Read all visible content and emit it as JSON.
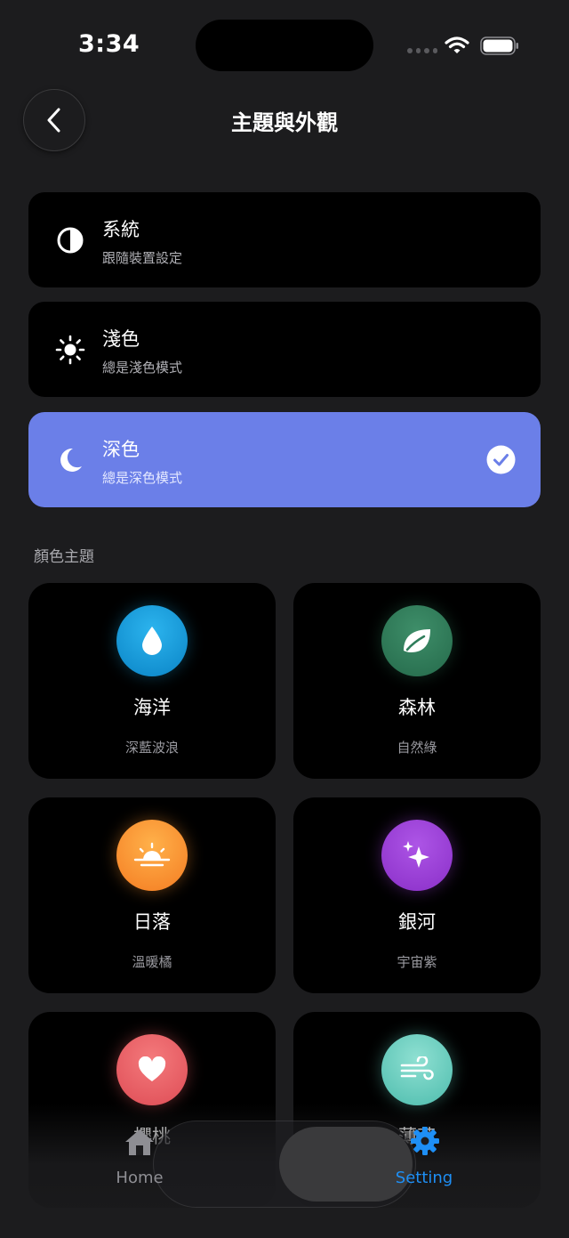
{
  "status": {
    "time": "3:34"
  },
  "header": {
    "title": "主題與外觀"
  },
  "modes": [
    {
      "title": "系統",
      "subtitle": "跟隨裝置設定",
      "icon": "half-circle-icon",
      "selected": false
    },
    {
      "title": "淺色",
      "subtitle": "總是淺色模式",
      "icon": "sun-icon",
      "selected": false
    },
    {
      "title": "深色",
      "subtitle": "總是深色模式",
      "icon": "moon-icon",
      "selected": true
    }
  ],
  "section": {
    "label": "顏色主題"
  },
  "themes": [
    {
      "name": "海洋",
      "subtitle": "深藍波浪",
      "icon": "water-drop-icon",
      "color": "#1aa0d8"
    },
    {
      "name": "森林",
      "subtitle": "自然綠",
      "icon": "leaf-icon",
      "color": "#2f7d5b"
    },
    {
      "name": "日落",
      "subtitle": "溫暖橘",
      "icon": "sunset-icon",
      "color": "#f7922e"
    },
    {
      "name": "銀河",
      "subtitle": "宇宙紫",
      "icon": "sparkle-icon",
      "color": "#9b3fd6"
    },
    {
      "name": "櫻桃",
      "subtitle": "",
      "icon": "heart-icon",
      "color": "#e85c62"
    },
    {
      "name": "薄荷",
      "subtitle": "",
      "icon": "wind-icon",
      "color": "#5ec8b8"
    }
  ],
  "tabbar": {
    "home_label": "Home",
    "setting_label": "Setting"
  },
  "colors": {
    "accent": "#6b7fe8",
    "tab_active": "#1e8ff5",
    "background": "#1c1c1e"
  }
}
